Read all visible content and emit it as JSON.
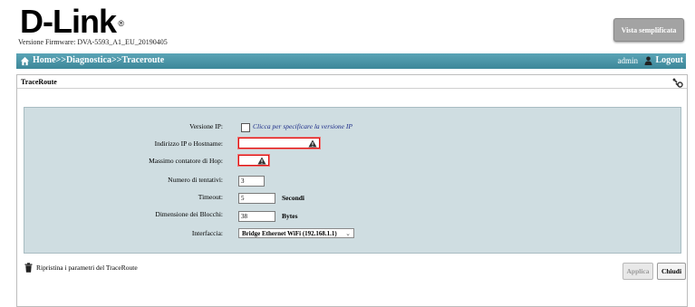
{
  "header": {
    "logo_text": "D-Link",
    "firmware": "Versione Firmware: DVA-5593_A1_EU_20190405",
    "simplified_view_label": "Vista semplificata"
  },
  "nav": {
    "breadcrumb": "Home>>Diagnostica>>Traceroute",
    "user": "admin",
    "logout_label": "Logout"
  },
  "panel": {
    "title": "TraceRoute"
  },
  "form": {
    "ip_version": {
      "label": "Versione IP:",
      "checkbox_text": "Clicca per specificare la versione IP"
    },
    "host": {
      "label": "Indirizzo IP o Hostname:",
      "value": ""
    },
    "max_hop": {
      "label": "Massimo contatore di Hop:",
      "value": ""
    },
    "attempts": {
      "label": "Numero di tentativi:",
      "value": "3"
    },
    "timeout": {
      "label": "Timeout:",
      "value": "5",
      "unit": "Secondi"
    },
    "block_size": {
      "label": "Dimensione dei Blocchi:",
      "value": "38",
      "unit": "Bytes"
    },
    "interface": {
      "label": "Interfaccia:",
      "selected": "Bridge Ethernet WiFi (192.168.1.1)"
    }
  },
  "footer": {
    "reset_label": "Ripristina i parametri del TraceRoute",
    "apply_label": "Applica",
    "close_label": "Chiudi"
  },
  "colors": {
    "nav_bar": "#4a96a8",
    "form_bg": "#cfdde1",
    "error_border": "#d11111"
  }
}
